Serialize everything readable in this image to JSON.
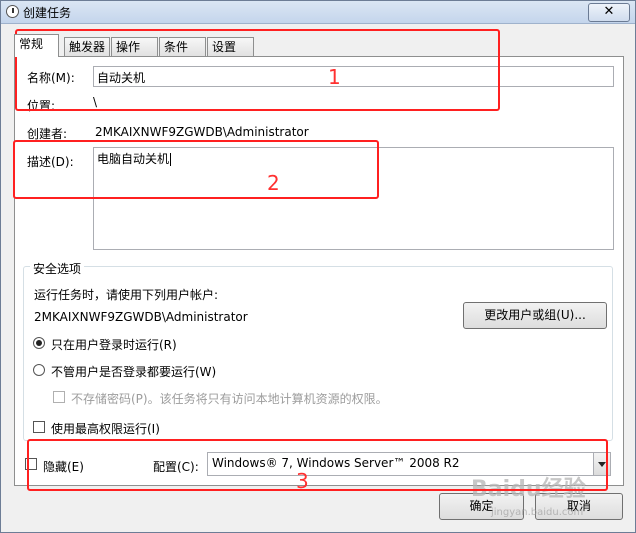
{
  "window": {
    "title": "创建任务",
    "close_glyph": "✕"
  },
  "tabs": [
    {
      "label": "常规"
    },
    {
      "label": "触发器"
    },
    {
      "label": "操作"
    },
    {
      "label": "条件"
    },
    {
      "label": "设置"
    }
  ],
  "general": {
    "name_label": "名称(M):",
    "name_value": "自动关机",
    "location_label": "位置:",
    "location_value": "\\",
    "author_label": "创建者:",
    "author_value": "2MKAIXNWF9ZGWDB\\Administrator",
    "desc_label": "描述(D):",
    "desc_value": "电脑自动关机"
  },
  "security": {
    "group_title": "安全选项",
    "run_as_label": "运行任务时，请使用下列用户帐户:",
    "user_value": "2MKAIXNWF9ZGWDB\\Administrator",
    "change_user_button": "更改用户或组(U)...",
    "radio_logged_on": "只在用户登录时运行(R)",
    "radio_whether": "不管用户是否登录都要运行(W)",
    "no_store_password": "不存储密码(P)。该任务将只有访问本地计算机资源的权限。",
    "highest_privileges": "使用最高权限运行(I)"
  },
  "bottom": {
    "hidden_label": "隐藏(E)",
    "config_label": "配置(C):",
    "config_value": "Windows® 7, Windows Server™ 2008 R2"
  },
  "buttons": {
    "ok": "确定",
    "cancel": "取消"
  },
  "annotations": {
    "num1": "1",
    "num2": "2",
    "num3": "3"
  },
  "watermark": {
    "main": "Baidu经验",
    "sub": "jingyan.baidu.com"
  }
}
